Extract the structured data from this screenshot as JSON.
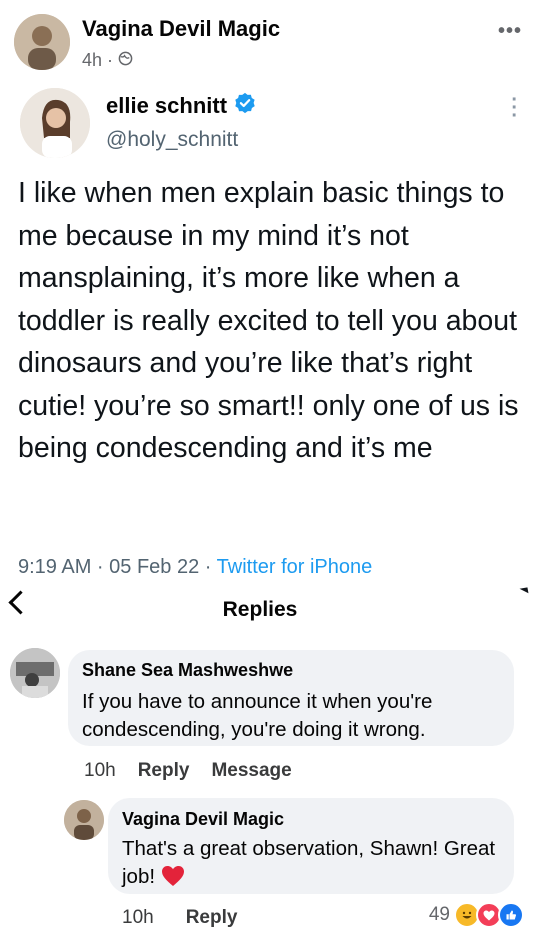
{
  "post": {
    "author": "Vagina Devil Magic",
    "time": "4h ·",
    "more_icon": "more-horizontal-icon",
    "privacy_icon": "globe-icon"
  },
  "tweet": {
    "name": "ellie schnitt",
    "handle": "@holy_schnitt",
    "verified_color": "#1d9bf0",
    "text": "I like when men explain basic things to me because in my mind it’s not mansplaining, it’s more like when a toddler is really excited to tell you about dinosaurs and you’re like that’s right cutie! you’re so smart!! only one of us is being condescending and it’s me",
    "time": "9:19 AM · 05 Feb 22 · ",
    "source": "Twitter for iPhone"
  },
  "replies": {
    "title": "Replies",
    "comments": [
      {
        "name": "Shane Sea Mashweshwe",
        "text": "If you have to announce it when you're condescending, you're doing it wrong.",
        "time": "10h",
        "reply_label": "Reply",
        "message_label": "Message"
      },
      {
        "name": "Vagina Devil Magic",
        "text": "That's a great observation, Shawn! Great job!",
        "time": "10h",
        "reply_label": "Reply",
        "reaction_count": "49"
      }
    ]
  }
}
